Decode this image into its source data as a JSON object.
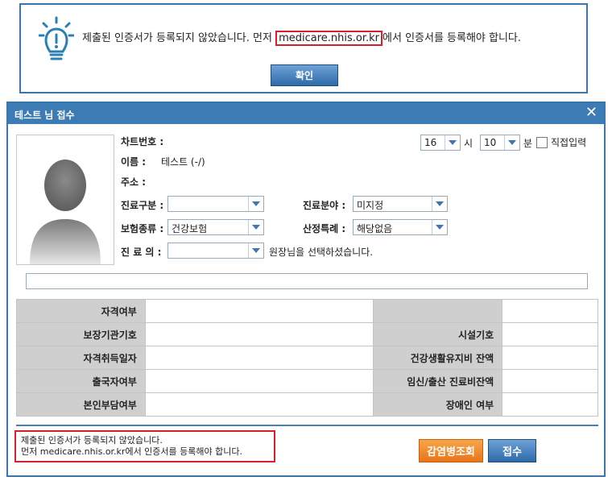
{
  "notice": {
    "msg_before": "제출된 인증서가 등록되지 않았습니다. 먼저 ",
    "msg_highlight": "medicare.nhis.or.kr",
    "msg_after": "에서 인증서를 등록해야 합니다.",
    "ok_label": "확인"
  },
  "dialog": {
    "title": "테스트 님 접수",
    "close": "✕",
    "chart_no_label": "차트번호 :",
    "name_label": "이름 :",
    "name_value": "테스트 (-/)",
    "address_label": "주소 :",
    "hour_value": "16",
    "hour_unit": "시",
    "minute_value": "10",
    "minute_unit": "분",
    "manual_entry_label": "직접입력",
    "care_type_label": "진료구분 :",
    "care_type_value": "",
    "dept_label": "진료분야 :",
    "dept_value": "미지정",
    "insurance_label": "보험종류 :",
    "insurance_value": "건강보험",
    "special_label": "산정특례 :",
    "special_value": "해당없음",
    "doctor_label": "진 료 의 :",
    "doctor_value": "",
    "doctor_hint": "원장님을 선택하셨습니다.",
    "grid": [
      {
        "left": "자격여부",
        "right": ""
      },
      {
        "left": "보장기관기호",
        "right": "시설기호"
      },
      {
        "left": "자격취득일자",
        "right": "건강생활유지비 잔액"
      },
      {
        "left": "출국자여부",
        "right": "임신/출산 진료비잔액"
      },
      {
        "left": "본인부담여부",
        "right": "장애인 여부"
      }
    ],
    "status_line1": "제출된 인증서가 등록되지 않았습니다.",
    "status_line2": "먼저 medicare.nhis.or.kr에서 인증서를 등록해야 합니다.",
    "btn_infection": "감염병조회",
    "btn_submit": "접수"
  },
  "colors": {
    "accent": "#3d7bb5",
    "alert": "#d8202a",
    "orange": "#e8741a"
  }
}
